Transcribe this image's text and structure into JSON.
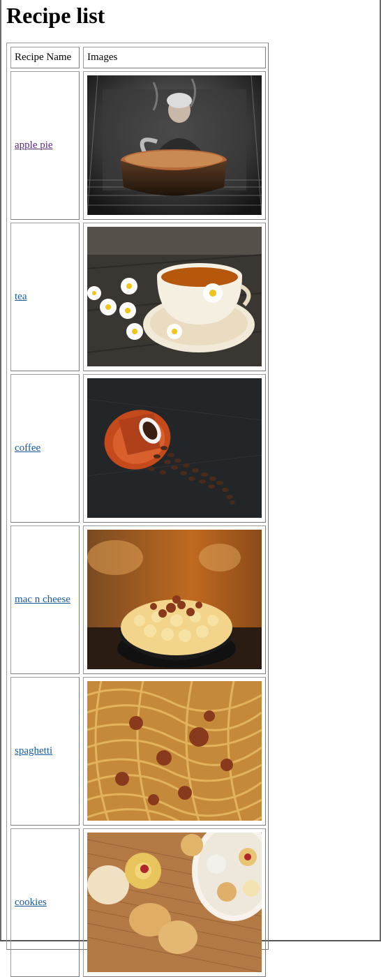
{
  "page": {
    "title": "Recipe list"
  },
  "table": {
    "headers": {
      "name": "Recipe Name",
      "images": "Images"
    },
    "rows": [
      {
        "name": "apple pie",
        "visited": true,
        "image": "apple-pie-photo"
      },
      {
        "name": "tea",
        "visited": false,
        "image": "tea-photo"
      },
      {
        "name": "coffee",
        "visited": false,
        "image": "coffee-photo"
      },
      {
        "name": "mac n cheese",
        "visited": false,
        "image": "mac-n-cheese-photo"
      },
      {
        "name": "spaghetti",
        "visited": false,
        "image": "spaghetti-photo"
      },
      {
        "name": "cookies",
        "visited": false,
        "image": "cookies-photo"
      }
    ]
  },
  "colors": {
    "link": "#1a5a9a",
    "visited_link": "#5a2a7a"
  }
}
